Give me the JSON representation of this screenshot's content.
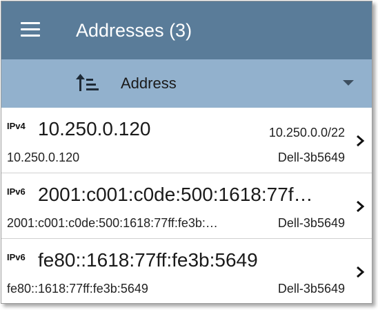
{
  "header": {
    "title": "Addresses (3)",
    "menu_icon": "hamburger-menu-icon",
    "background": "#5a7c99"
  },
  "sort_bar": {
    "sort_icon": "sort-ascending-icon",
    "selected": "Address",
    "dropdown_icon": "dropdown-arrow-icon",
    "background": "#92b1cd"
  },
  "addresses": [
    {
      "type": "IPv4",
      "address": "10.250.0.120",
      "network": "10.250.0.0/22",
      "detail": "10.250.0.120",
      "vendor": "Dell-3b5649"
    },
    {
      "type": "IPv6",
      "address": "2001:c001:c0de:500:1618:77f…",
      "network": "",
      "detail": "2001:c001:c0de:500:1618:77ff:fe3b:…",
      "vendor": "Dell-3b5649"
    },
    {
      "type": "IPv6",
      "address": "fe80::1618:77ff:fe3b:5649",
      "network": "",
      "detail": "fe80::1618:77ff:fe3b:5649",
      "vendor": "Dell-3b5649"
    }
  ]
}
